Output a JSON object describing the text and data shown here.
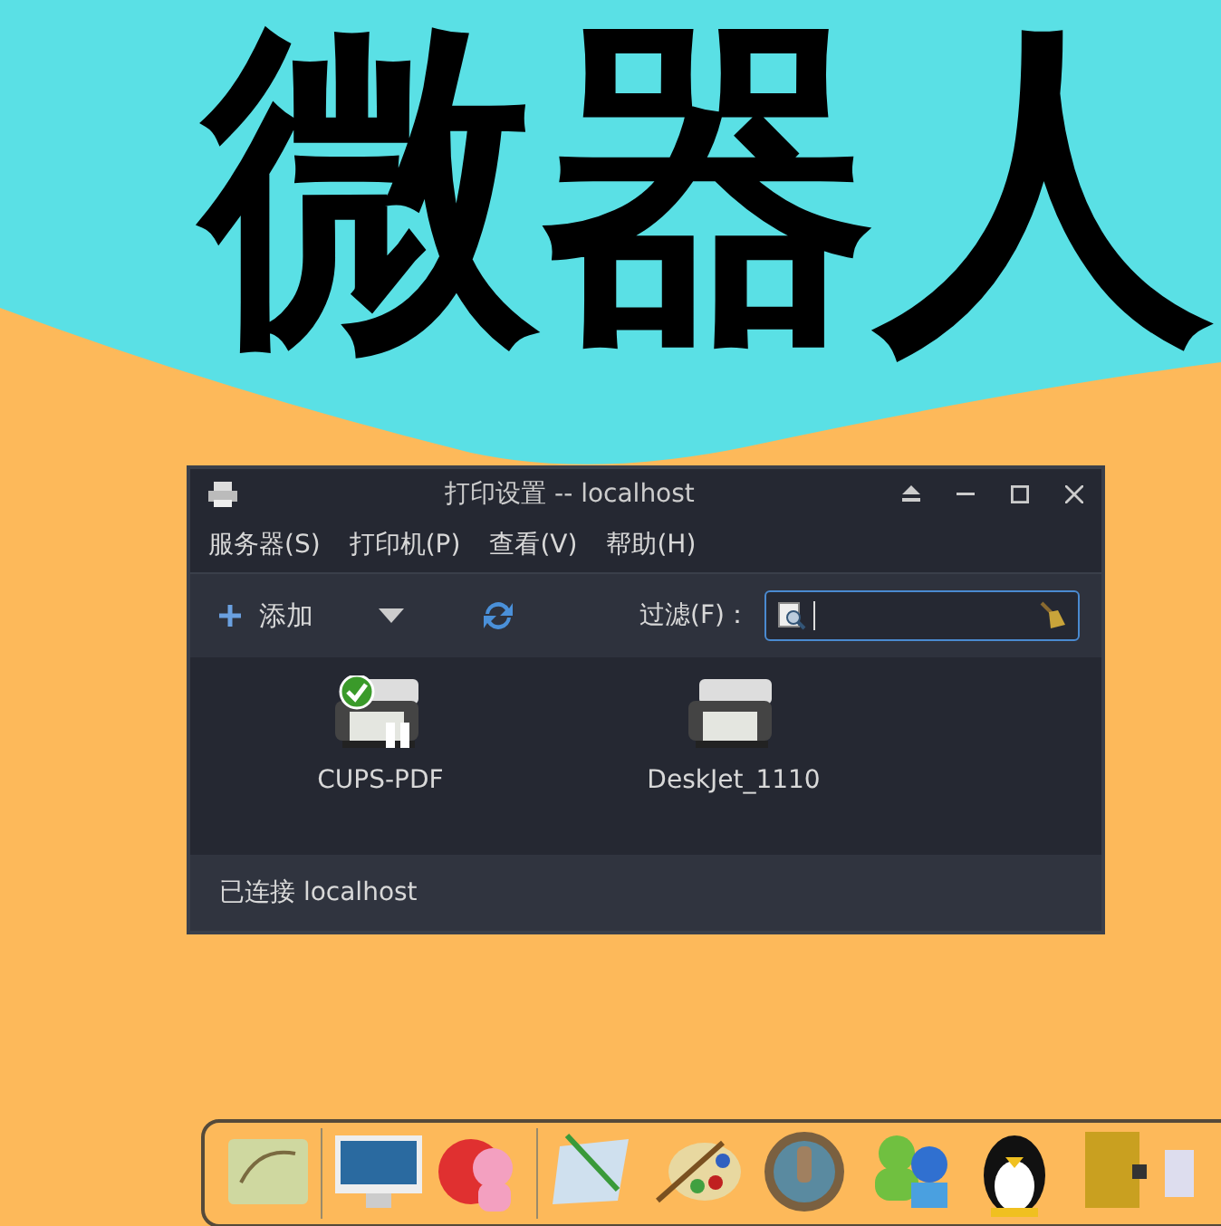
{
  "background": {
    "headline": "微器人"
  },
  "window": {
    "title": "打印设置 -- localhost"
  },
  "menu": [
    "服务器(S)",
    "打印机(P)",
    "查看(V)",
    "帮助(H)"
  ],
  "toolbar": {
    "add_label": "添加",
    "filter_label": "过滤(F)："
  },
  "printers": [
    {
      "name": "CUPS-PDF",
      "default": true
    },
    {
      "name": "DeskJet_1110",
      "default": false
    }
  ],
  "status_bar": "已连接 localhost"
}
